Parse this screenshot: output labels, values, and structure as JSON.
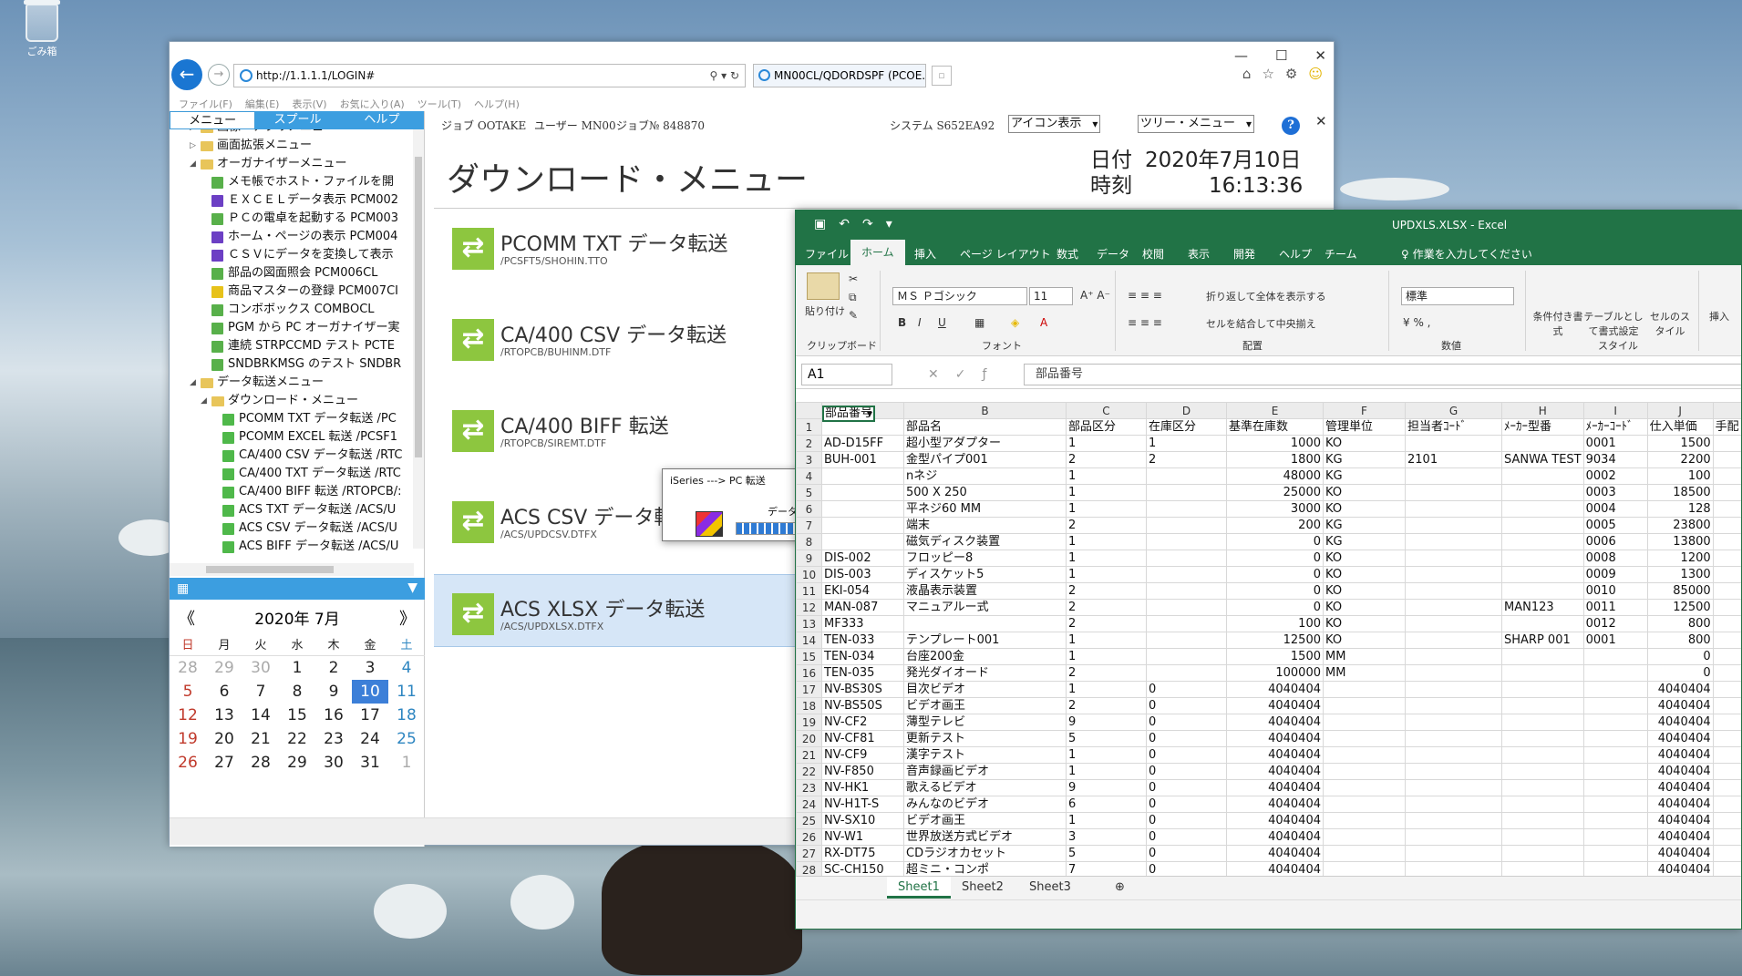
{
  "desktop": {
    "recycle_label": "ごみ箱"
  },
  "ie": {
    "address": "http://1.1.1.1/LOGIN#",
    "tab_title": "MN00CL/QDORDSPF (PCOE...",
    "menubar": [
      "ファイル(F)",
      "編集(E)",
      "表示(V)",
      "お気に入り(A)",
      "ツール(T)",
      "ヘルプ(H)"
    ]
  },
  "sidebar": {
    "tabs": [
      "メニュー",
      "スプール",
      "ヘルプ"
    ],
    "tree": [
      {
        "label": "画像・アプリメニュー",
        "level": 1,
        "type": "folder",
        "tri": "▷"
      },
      {
        "label": "画面拡張メニュー",
        "level": 1,
        "type": "folder",
        "tri": "▷"
      },
      {
        "label": "オーガナイザーメニュー",
        "level": 1,
        "type": "folder",
        "tri": "◢"
      },
      {
        "label": "メモ帳でホスト・ファイルを開",
        "level": 2,
        "type": "green"
      },
      {
        "label": "ＥＸＣＥＬデータ表示 PCM002",
        "level": 2,
        "type": "purple"
      },
      {
        "label": "ＰＣの電卓を起動する PCM003",
        "level": 2,
        "type": "green"
      },
      {
        "label": "ホーム・ページの表示 PCM004",
        "level": 2,
        "type": "purple"
      },
      {
        "label": "ＣＳＶにデータを変換して表示",
        "level": 2,
        "type": "purple"
      },
      {
        "label": "部品の図面照会 PCM006CL",
        "level": 2,
        "type": "green"
      },
      {
        "label": "商品マスターの登録 PCM007CI",
        "level": 2,
        "type": "yellow"
      },
      {
        "label": "コンボボックス COMBOCL",
        "level": 2,
        "type": "green"
      },
      {
        "label": "PGM から PC オーガナイザー実",
        "level": 2,
        "type": "green"
      },
      {
        "label": "連続 STRPCCMD テスト PCTE",
        "level": 2,
        "type": "green"
      },
      {
        "label": "SNDBRKMSG のテスト SNDBR",
        "level": 2,
        "type": "green"
      },
      {
        "label": "データ転送メニュー",
        "level": 1,
        "type": "folder",
        "tri": "◢"
      },
      {
        "label": "ダウンロード・メニュー",
        "level": 2,
        "type": "folder",
        "tri": "◢"
      },
      {
        "label": "PCOMM TXT データ転送 /PC",
        "level": 3,
        "type": "greenxfer"
      },
      {
        "label": "PCOMM EXCEL 転送 /PCSF1",
        "level": 3,
        "type": "greenxfer"
      },
      {
        "label": "CA/400 CSV データ転送 /RTC",
        "level": 3,
        "type": "greenxfer"
      },
      {
        "label": "CA/400 TXT データ転送 /RTC",
        "level": 3,
        "type": "greenxfer"
      },
      {
        "label": "CA/400 BIFF 転送 /RTOPCB/:",
        "level": 3,
        "type": "greenxfer"
      },
      {
        "label": "ACS TXT データ転送 /ACS/U",
        "level": 3,
        "type": "greenxfer"
      },
      {
        "label": "ACS CSV データ転送 /ACS/U",
        "level": 3,
        "type": "greenxfer"
      },
      {
        "label": "ACS BIFF データ転送 /ACS/U",
        "level": 3,
        "type": "greenxfer"
      }
    ]
  },
  "calendar": {
    "title": "2020年 7月",
    "prev": "《",
    "next": "》",
    "dow": [
      "日",
      "月",
      "火",
      "水",
      "木",
      "金",
      "土"
    ],
    "weeks": [
      [
        "28",
        "29",
        "30",
        "1",
        "2",
        "3",
        "4"
      ],
      [
        "5",
        "6",
        "7",
        "8",
        "9",
        "10",
        "11"
      ],
      [
        "12",
        "13",
        "14",
        "15",
        "16",
        "17",
        "18"
      ],
      [
        "19",
        "20",
        "21",
        "22",
        "23",
        "24",
        "25"
      ],
      [
        "26",
        "27",
        "28",
        "29",
        "30",
        "31",
        "1"
      ]
    ],
    "today": "10"
  },
  "main": {
    "job": "ジョブ OOTAKE",
    "user": "ユーザー MN00",
    "jobno": "ジョブ№ 848870",
    "system": "システム S652EA92",
    "icon_view": "アイコン表示",
    "tree_menu": "ツリー・メニュー",
    "title": "ダウンロード・メニュー",
    "date_label": "日付",
    "date_value": "2020年7月10日",
    "time_label": "時刻",
    "time_value": "16:13:36",
    "transfers": [
      {
        "title": "PCOMM TXT データ転送",
        "path": "/PCSFT5/SHOHIN.TTO"
      },
      {
        "title": "CA/400 CSV データ転送",
        "path": "/RTOPCB/BUHINM.DTF"
      },
      {
        "title": "CA/400 BIFF 転送",
        "path": "/RTOPCB/SIREMT.DTF"
      },
      {
        "title": "ACS CSV データ転送",
        "path": "/ACS/UPDCSV.DTFX"
      },
      {
        "title": "ACS XLSX データ転送",
        "path": "/ACS/UPDXLSX.DTFX"
      }
    ]
  },
  "dialog": {
    "title": "iSeries ---> PC 転送",
    "message": "データを転送中...",
    "progress": 1.0
  },
  "excel": {
    "title": "UPDXLS.XLSX  -  Excel",
    "tabs": [
      "ファイル",
      "ホーム",
      "挿入",
      "ページ レイアウト",
      "数式",
      "データ",
      "校閲",
      "表示",
      "開発",
      "ヘルプ",
      "チーム",
      "作業を入力してください"
    ],
    "ribbon": {
      "paste": "貼り付け",
      "clipboard": "クリップボード",
      "font_name": "ＭＳ Ｐゴシック",
      "font_size": "11",
      "font": "フォント",
      "wrap": "折り返して全体を表示する",
      "merge": "セルを結合して中央揃え",
      "align": "配置",
      "number_format": "標準",
      "number": "数値",
      "cond": "条件付き書式",
      "table": "テーブルとして書式設定",
      "cellstyle": "セルのスタイル",
      "style": "スタイル",
      "insert": "挿入"
    },
    "namebox": "A1",
    "formula": "部品番号",
    "columns": [
      "A",
      "B",
      "C",
      "D",
      "E",
      "F",
      "G",
      "H",
      "I",
      "J"
    ],
    "rows": [
      [
        "部品番号",
        "部品名",
        "部品区分",
        "在庫区分",
        "基準在庫数",
        "管理単位",
        "担当者ｺｰﾄﾞ",
        "ﾒｰｶｰ型番",
        "ﾒｰｶｰｺｰﾄﾞ",
        "仕入単価"
      ],
      [
        "AD-D15FF",
        "超小型アダプター",
        "1",
        "1",
        "1000",
        "KO",
        "",
        "",
        "0001",
        "1500"
      ],
      [
        "BUH-001",
        "金型パイプ001",
        "2",
        "2",
        "1800",
        "KG",
        "2101",
        "SANWA TEST",
        "9034",
        "2200"
      ],
      [
        "",
        "nネジ",
        "1",
        "",
        "48000",
        "KG",
        "",
        "",
        "0002",
        "100"
      ],
      [
        "",
        "500 X 250",
        "1",
        "",
        "25000",
        "KO",
        "",
        "",
        "0003",
        "18500"
      ],
      [
        "",
        "平ネジ60 MM",
        "1",
        "",
        "3000",
        "KO",
        "",
        "",
        "0004",
        "128"
      ],
      [
        "",
        "端末",
        "2",
        "",
        "200",
        "KG",
        "",
        "",
        "0005",
        "23800"
      ],
      [
        "",
        "磁気ディスク装置",
        "1",
        "",
        "0",
        "KG",
        "",
        "",
        "0006",
        "13800"
      ],
      [
        "DIS-002",
        "フロッピー8",
        "1",
        "",
        "0",
        "KO",
        "",
        "",
        "0008",
        "1200"
      ],
      [
        "DIS-003",
        "ディスケット5",
        "1",
        "",
        "0",
        "KO",
        "",
        "",
        "0009",
        "1300"
      ],
      [
        "EKI-054",
        "液晶表示装置",
        "2",
        "",
        "0",
        "KO",
        "",
        "",
        "0010",
        "85000"
      ],
      [
        "MAN-087",
        "マニュアルー式",
        "2",
        "",
        "0",
        "KO",
        "",
        "MAN123",
        "0011",
        "12500"
      ],
      [
        "MF333",
        "",
        "2",
        "",
        "100",
        "KO",
        "",
        "",
        "0012",
        "800"
      ],
      [
        "TEN-033",
        "テンプレート001",
        "1",
        "",
        "12500",
        "KO",
        "",
        "SHARP 001",
        "0001",
        "800"
      ],
      [
        "TEN-034",
        "台座200金",
        "1",
        "",
        "1500",
        "MM",
        "",
        "",
        "",
        "0"
      ],
      [
        "TEN-035",
        "発光ダイオード",
        "2",
        "",
        "100000",
        "MM",
        "",
        "",
        "",
        "0"
      ],
      [
        "NV-BS30S",
        "目次ビデオ",
        "1",
        "0",
        "4040404",
        "",
        "",
        "",
        "",
        "4040404"
      ],
      [
        "NV-BS50S",
        "ビデオ画王",
        "2",
        "0",
        "4040404",
        "",
        "",
        "",
        "",
        "4040404"
      ],
      [
        "NV-CF2",
        "薄型テレビ",
        "9",
        "0",
        "4040404",
        "",
        "",
        "",
        "",
        "4040404"
      ],
      [
        "NV-CF81",
        "更新テスト",
        "5",
        "0",
        "4040404",
        "",
        "",
        "",
        "",
        "4040404"
      ],
      [
        "NV-CF9",
        "漢字テスト",
        "1",
        "0",
        "4040404",
        "",
        "",
        "",
        "",
        "4040404"
      ],
      [
        "NV-F850",
        "音声録画ビデオ",
        "1",
        "0",
        "4040404",
        "",
        "",
        "",
        "",
        "4040404"
      ],
      [
        "NV-HK1",
        "歌えるビデオ",
        "9",
        "0",
        "4040404",
        "",
        "",
        "",
        "",
        "4040404"
      ],
      [
        "NV-H1T-S",
        "みんなのビデオ",
        "6",
        "0",
        "4040404",
        "",
        "",
        "",
        "",
        "4040404"
      ],
      [
        "NV-SX10",
        "ビデオ画王",
        "1",
        "0",
        "4040404",
        "",
        "",
        "",
        "",
        "4040404"
      ],
      [
        "NV-W1",
        "世界放送方式ビデオ",
        "3",
        "0",
        "4040404",
        "",
        "",
        "",
        "",
        "4040404"
      ],
      [
        "RX-DT75",
        "CDラジオカセット",
        "5",
        "0",
        "4040404",
        "",
        "",
        "",
        "",
        "4040404"
      ],
      [
        "SC-CH150",
        "超ミニ・コンポ",
        "7",
        "0",
        "4040404",
        "",
        "",
        "",
        "",
        "4040404"
      ]
    ],
    "extra_col_header": "手配",
    "sheets": [
      "Sheet1",
      "Sheet2",
      "Sheet3"
    ]
  }
}
